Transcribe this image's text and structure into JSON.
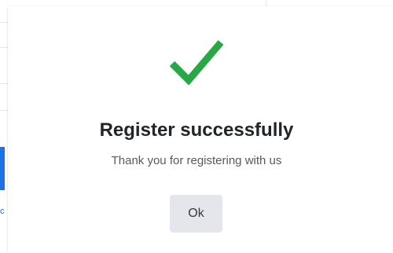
{
  "background": {
    "side_fragment": "c"
  },
  "dialog": {
    "icon": "checkmark-icon",
    "title": "Register successfully",
    "message": "Thank you for registering with us",
    "ok_label": "Ok"
  },
  "colors": {
    "success": "#27a844",
    "accent": "#1a73e8",
    "button_bg": "#e4e6eb",
    "title": "#212529",
    "message": "#555a60"
  }
}
